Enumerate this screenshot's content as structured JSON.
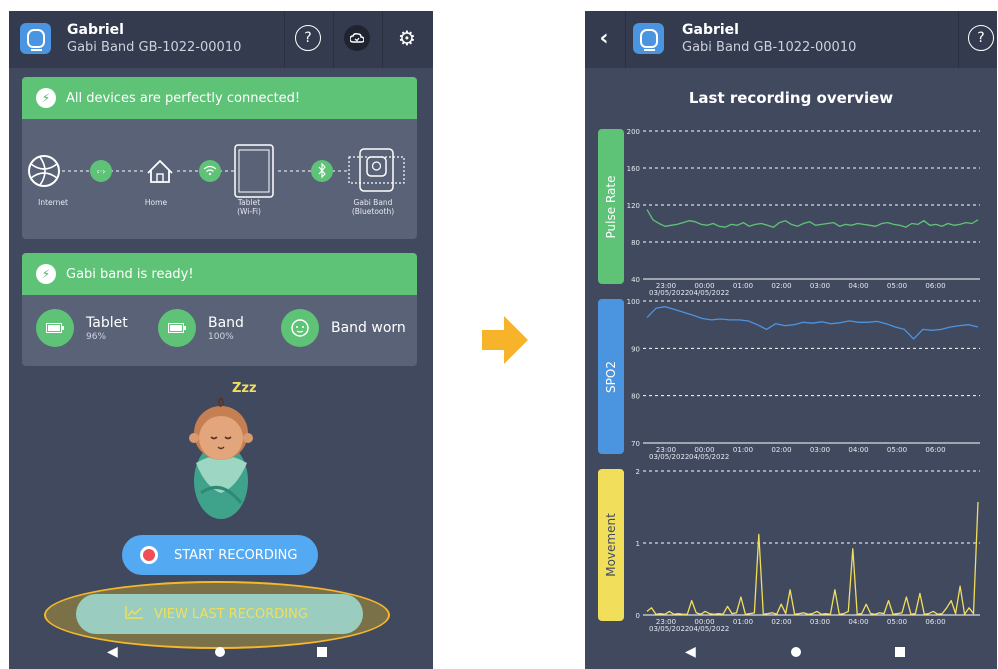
{
  "colors": {
    "accent_green": "#5fc377",
    "accent_blue": "#4b94e0",
    "accent_yellow": "#f1de5b",
    "background": "#41495f",
    "arrow_orange": "#f7b329"
  },
  "left": {
    "header": {
      "name": "Gabriel",
      "device": "Gabi Band GB-1022-00010",
      "icons": [
        "help-icon",
        "cloud-icon",
        "gear-icon"
      ]
    },
    "status_card": {
      "title": "All devices are perfectly connected!",
      "nodes": [
        {
          "icon": "globe-icon",
          "label": "Internet",
          "sub": ""
        },
        {
          "icon": "home-icon",
          "label": "Home",
          "sub": ""
        },
        {
          "icon": "tablet-icon",
          "label": "Tablet",
          "sub": "(Wi-Fi)"
        },
        {
          "icon": "band-icon",
          "label": "Gabi Band",
          "sub": "(Bluetooth)"
        }
      ],
      "links": [
        "ethernet-icon",
        "wifi-icon",
        "bluetooth-icon"
      ]
    },
    "ready_card": {
      "title": "Gabi band is ready!",
      "tablet": {
        "label": "Tablet",
        "value": "96%"
      },
      "band": {
        "label": "Band",
        "value": "100%"
      },
      "worn": {
        "label": "Band worn"
      }
    },
    "sleep_text": "Zzz",
    "start_button": "START RECORDING",
    "view_button": "VIEW LAST RECORDING"
  },
  "right": {
    "header": {
      "name": "Gabriel",
      "device": "Gabi Band GB-1022-00010"
    },
    "title": "Last recording overview",
    "x_ticks": [
      "23:00",
      "00:00",
      "01:00",
      "02:00",
      "03:00",
      "04:00",
      "05:00",
      "06:00"
    ],
    "dates": [
      "03/05/2022",
      "04/05/2022"
    ]
  },
  "chart_data": [
    {
      "type": "line",
      "title": "Pulse Rate",
      "ylim": [
        40,
        200
      ],
      "yticks": [
        40,
        80,
        120,
        160,
        200
      ],
      "series": [
        {
          "values": [
            115,
            104,
            100,
            97,
            98,
            99,
            101,
            103,
            102,
            99,
            98,
            100,
            97,
            96,
            99,
            98,
            101,
            97,
            99,
            100,
            98,
            96,
            101,
            103,
            99,
            97,
            100,
            102,
            98,
            99,
            100,
            101,
            97,
            99,
            98,
            100,
            99,
            98,
            97,
            100,
            101,
            99,
            98,
            96,
            100,
            99,
            103,
            98,
            99,
            97,
            100,
            98,
            99,
            101,
            100,
            104
          ]
        }
      ]
    },
    {
      "type": "line",
      "title": "SPO2",
      "ylim": [
        70,
        100
      ],
      "yticks": [
        70,
        80,
        90,
        100
      ],
      "series": [
        {
          "values": [
            96.5,
            98.5,
            98.8,
            98.2,
            97.6,
            97,
            96.3,
            96,
            96.2,
            96,
            96,
            95.8,
            95,
            94,
            95.2,
            94.8,
            95,
            95.5,
            95.3,
            95.6,
            95.2,
            95.4,
            95.8,
            95.5,
            95.5,
            95.7,
            95.2,
            94.5,
            94,
            92,
            94,
            93.8,
            94,
            94.5,
            94.8,
            95,
            94.5
          ]
        }
      ]
    },
    {
      "type": "line",
      "title": "Movement",
      "ylim": [
        0,
        2
      ],
      "yticks": [
        0,
        1,
        2
      ],
      "series": [
        {
          "values": [
            0.05,
            0.1,
            0.01,
            0.02,
            0.01,
            0.05,
            0.01,
            0.02,
            0.01,
            0.01,
            0.2,
            0.03,
            0.01,
            0.05,
            0.02,
            0.01,
            0.02,
            0.01,
            0.12,
            0.02,
            0.03,
            0.25,
            0.01,
            0.02,
            0.03,
            1.12,
            0.01,
            0.02,
            0.03,
            0.01,
            0.15,
            0.02,
            0.35,
            0.01,
            0.02,
            0.03,
            0.01,
            0.02,
            0.05,
            0.01,
            0.02,
            0.01,
            0.35,
            0.01,
            0.02,
            0.05,
            0.92,
            0.01,
            0.02,
            0.15,
            0.02,
            0.01,
            0.03,
            0.02,
            0.2,
            0.01,
            0.02,
            0.03,
            0.25,
            0.01,
            0.02,
            0.3,
            0.01,
            0.02,
            0.05,
            0.01,
            0.02,
            0.1,
            0.2,
            0.02,
            0.4,
            0.01,
            0.1,
            0.02,
            1.57
          ]
        }
      ]
    }
  ]
}
